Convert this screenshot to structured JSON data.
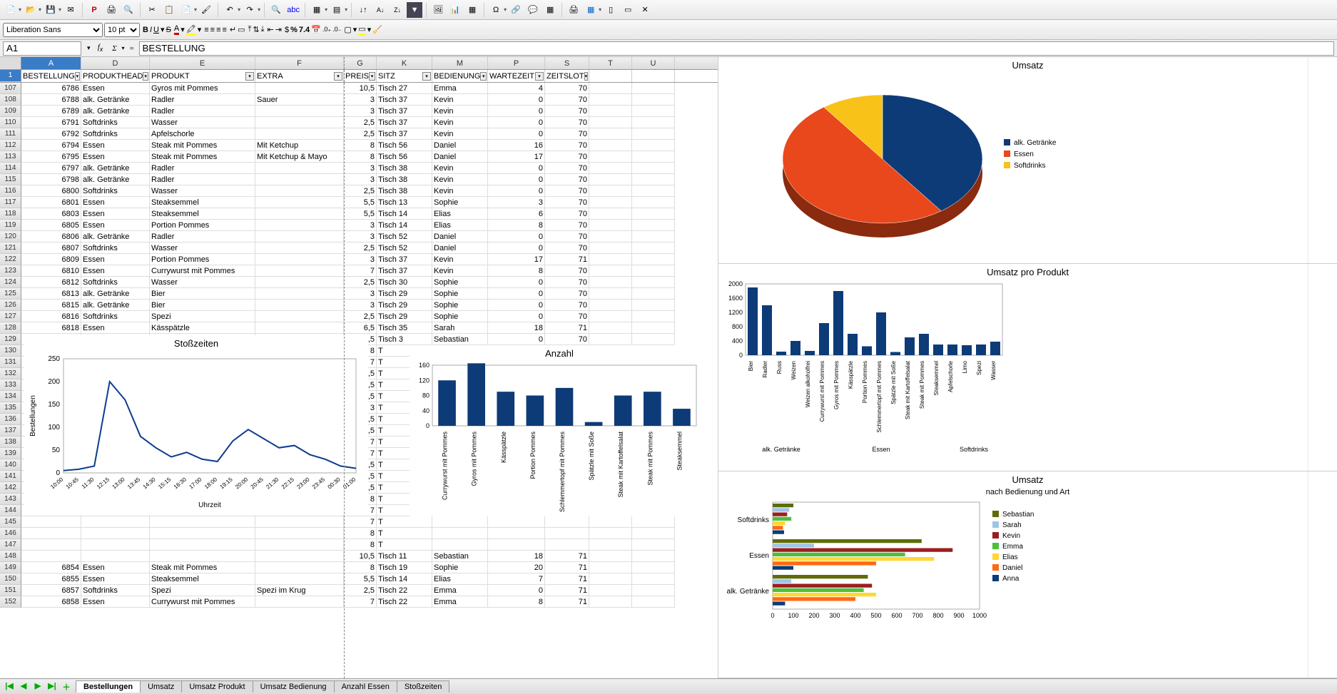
{
  "app": {
    "font_name": "Liberation Sans",
    "font_size": "10 pt"
  },
  "cell_reference": "A1",
  "formula_value": "BESTELLUNG",
  "columns": [
    {
      "id": "A",
      "label": "A",
      "w": "col-A"
    },
    {
      "id": "D",
      "label": "D",
      "w": "col-D"
    },
    {
      "id": "E",
      "label": "E",
      "w": "col-El"
    },
    {
      "id": "F",
      "label": "F",
      "w": "col-F"
    },
    {
      "id": "G",
      "label": "G",
      "w": "col-G"
    },
    {
      "id": "K",
      "label": "K",
      "w": "col-K"
    },
    {
      "id": "M",
      "label": "M",
      "w": "col-M"
    },
    {
      "id": "P",
      "label": "P",
      "w": "col-P"
    },
    {
      "id": "S",
      "label": "S",
      "w": "col-S"
    },
    {
      "id": "T",
      "label": "T",
      "w": "col-T"
    },
    {
      "id": "U",
      "label": "U",
      "w": "col-U"
    }
  ],
  "filters": [
    "BESTELLUNG",
    "PRODUKTHEAD",
    "PRODUKT",
    "EXTRA",
    "PREIS",
    "SITZ",
    "BEDIENUNG",
    "WARTEZEIT",
    "ZEITSLOT",
    "",
    ""
  ],
  "rows": [
    {
      "n": 107,
      "a": "6786",
      "d": "Essen",
      "e": "Gyros mit Pommes",
      "f": "",
      "g": "10,5",
      "k": "Tisch 27",
      "m": "Emma",
      "p": "4",
      "s": "70"
    },
    {
      "n": 108,
      "a": "6788",
      "d": "alk. Getränke",
      "e": "Radler",
      "f": "Sauer",
      "g": "3",
      "k": "Tisch 37",
      "m": "Kevin",
      "p": "0",
      "s": "70"
    },
    {
      "n": 109,
      "a": "6789",
      "d": "alk. Getränke",
      "e": "Radler",
      "f": "",
      "g": "3",
      "k": "Tisch 37",
      "m": "Kevin",
      "p": "0",
      "s": "70"
    },
    {
      "n": 110,
      "a": "6791",
      "d": "Softdrinks",
      "e": "Wasser",
      "f": "",
      "g": "2,5",
      "k": "Tisch 37",
      "m": "Kevin",
      "p": "0",
      "s": "70"
    },
    {
      "n": 111,
      "a": "6792",
      "d": "Softdrinks",
      "e": "Apfelschorle",
      "f": "",
      "g": "2,5",
      "k": "Tisch 37",
      "m": "Kevin",
      "p": "0",
      "s": "70"
    },
    {
      "n": 112,
      "a": "6794",
      "d": "Essen",
      "e": "Steak mit Pommes",
      "f": "Mit Ketchup",
      "g": "8",
      "k": "Tisch 56",
      "m": "Daniel",
      "p": "16",
      "s": "70"
    },
    {
      "n": 113,
      "a": "6795",
      "d": "Essen",
      "e": "Steak mit Pommes",
      "f": "Mit Ketchup & Mayo",
      "g": "8",
      "k": "Tisch 56",
      "m": "Daniel",
      "p": "17",
      "s": "70"
    },
    {
      "n": 114,
      "a": "6797",
      "d": "alk. Getränke",
      "e": "Radler",
      "f": "",
      "g": "3",
      "k": "Tisch 38",
      "m": "Kevin",
      "p": "0",
      "s": "70"
    },
    {
      "n": 115,
      "a": "6798",
      "d": "alk. Getränke",
      "e": "Radler",
      "f": "",
      "g": "3",
      "k": "Tisch 38",
      "m": "Kevin",
      "p": "0",
      "s": "70"
    },
    {
      "n": 116,
      "a": "6800",
      "d": "Softdrinks",
      "e": "Wasser",
      "f": "",
      "g": "2,5",
      "k": "Tisch 38",
      "m": "Kevin",
      "p": "0",
      "s": "70"
    },
    {
      "n": 117,
      "a": "6801",
      "d": "Essen",
      "e": "Steaksemmel",
      "f": "",
      "g": "5,5",
      "k": "Tisch 13",
      "m": "Sophie",
      "p": "3",
      "s": "70"
    },
    {
      "n": 118,
      "a": "6803",
      "d": "Essen",
      "e": "Steaksemmel",
      "f": "",
      "g": "5,5",
      "k": "Tisch 14",
      "m": "Elias",
      "p": "6",
      "s": "70"
    },
    {
      "n": 119,
      "a": "6805",
      "d": "Essen",
      "e": "Portion Pommes",
      "f": "",
      "g": "3",
      "k": "Tisch 14",
      "m": "Elias",
      "p": "8",
      "s": "70"
    },
    {
      "n": 120,
      "a": "6806",
      "d": "alk. Getränke",
      "e": "Radler",
      "f": "",
      "g": "3",
      "k": "Tisch 52",
      "m": "Daniel",
      "p": "0",
      "s": "70"
    },
    {
      "n": 121,
      "a": "6807",
      "d": "Softdrinks",
      "e": "Wasser",
      "f": "",
      "g": "2,5",
      "k": "Tisch 52",
      "m": "Daniel",
      "p": "0",
      "s": "70"
    },
    {
      "n": 122,
      "a": "6809",
      "d": "Essen",
      "e": "Portion Pommes",
      "f": "",
      "g": "3",
      "k": "Tisch 37",
      "m": "Kevin",
      "p": "17",
      "s": "71"
    },
    {
      "n": 123,
      "a": "6810",
      "d": "Essen",
      "e": "Currywurst mit Pommes",
      "f": "",
      "g": "7",
      "k": "Tisch 37",
      "m": "Kevin",
      "p": "8",
      "s": "70"
    },
    {
      "n": 124,
      "a": "6812",
      "d": "Softdrinks",
      "e": "Wasser",
      "f": "",
      "g": "2,5",
      "k": "Tisch 30",
      "m": "Sophie",
      "p": "0",
      "s": "70"
    },
    {
      "n": 125,
      "a": "6813",
      "d": "alk. Getränke",
      "e": "Bier",
      "f": "",
      "g": "3",
      "k": "Tisch 29",
      "m": "Sophie",
      "p": "0",
      "s": "70"
    },
    {
      "n": 126,
      "a": "6815",
      "d": "alk. Getränke",
      "e": "Bier",
      "f": "",
      "g": "3",
      "k": "Tisch 29",
      "m": "Sophie",
      "p": "0",
      "s": "70"
    },
    {
      "n": 127,
      "a": "6816",
      "d": "Softdrinks",
      "e": "Spezi",
      "f": "",
      "g": "2,5",
      "k": "Tisch 29",
      "m": "Sophie",
      "p": "0",
      "s": "70"
    },
    {
      "n": 128,
      "a": "6818",
      "d": "Essen",
      "e": "Kässpätzle",
      "f": "",
      "g": "6,5",
      "k": "Tisch 35",
      "m": "Sarah",
      "p": "18",
      "s": "71"
    },
    {
      "n": 129,
      "a": "",
      "d": "",
      "e": "",
      "f": "",
      "g": "2,5",
      "k": "Tisch 3",
      "m": "Sebastian",
      "p": "0",
      "s": "70"
    },
    {
      "n": 130,
      "a": "",
      "d": "",
      "e": "",
      "f": "",
      "g": "8",
      "k": "T",
      "m": "",
      "p": "",
      "s": ""
    },
    {
      "n": 131,
      "a": "",
      "d": "",
      "e": "",
      "f": "",
      "g": "7",
      "k": "T",
      "m": "",
      "p": "",
      "s": ""
    },
    {
      "n": 132,
      "a": "",
      "d": "",
      "e": "",
      "f": "",
      "g": "5,5",
      "k": "T",
      "m": "",
      "p": "",
      "s": ""
    },
    {
      "n": 133,
      "a": "",
      "d": "",
      "e": "",
      "f": "",
      "g": "2,5",
      "k": "T",
      "m": "",
      "p": "",
      "s": ""
    },
    {
      "n": 134,
      "a": "",
      "d": "",
      "e": "",
      "f": "",
      "g": "2,5",
      "k": "T",
      "m": "",
      "p": "",
      "s": ""
    },
    {
      "n": 135,
      "a": "",
      "d": "",
      "e": "",
      "f": "",
      "g": "3",
      "k": "T",
      "m": "",
      "p": "",
      "s": ""
    },
    {
      "n": 136,
      "a": "",
      "d": "",
      "e": "",
      "f": "",
      "g": "2,5",
      "k": "T",
      "m": "",
      "p": "",
      "s": ""
    },
    {
      "n": 137,
      "a": "",
      "d": "",
      "e": "",
      "f": "",
      "g": "3,5",
      "k": "T",
      "m": "",
      "p": "",
      "s": ""
    },
    {
      "n": 138,
      "a": "",
      "d": "",
      "e": "",
      "f": "",
      "g": "7",
      "k": "T",
      "m": "",
      "p": "",
      "s": ""
    },
    {
      "n": 139,
      "a": "",
      "d": "",
      "e": "",
      "f": "",
      "g": "7",
      "k": "T",
      "m": "",
      "p": "",
      "s": ""
    },
    {
      "n": 140,
      "a": "",
      "d": "",
      "e": "",
      "f": "",
      "g": "3,5",
      "k": "T",
      "m": "",
      "p": "",
      "s": ""
    },
    {
      "n": 141,
      "a": "",
      "d": "",
      "e": "",
      "f": "",
      "g": "2,5",
      "k": "T",
      "m": "",
      "p": "",
      "s": ""
    },
    {
      "n": 142,
      "a": "",
      "d": "",
      "e": "",
      "f": "",
      "g": "2,5",
      "k": "T",
      "m": "",
      "p": "",
      "s": ""
    },
    {
      "n": 143,
      "a": "",
      "d": "",
      "e": "",
      "f": "",
      "g": "8",
      "k": "T",
      "m": "",
      "p": "",
      "s": ""
    },
    {
      "n": 144,
      "a": "",
      "d": "",
      "e": "",
      "f": "",
      "g": "7",
      "k": "T",
      "m": "",
      "p": "",
      "s": ""
    },
    {
      "n": 145,
      "a": "",
      "d": "",
      "e": "",
      "f": "",
      "g": "7",
      "k": "T",
      "m": "",
      "p": "",
      "s": ""
    },
    {
      "n": 146,
      "a": "",
      "d": "",
      "e": "",
      "f": "",
      "g": "8",
      "k": "T",
      "m": "",
      "p": "",
      "s": ""
    },
    {
      "n": 147,
      "a": "",
      "d": "",
      "e": "",
      "f": "",
      "g": "8",
      "k": "T",
      "m": "",
      "p": "",
      "s": ""
    },
    {
      "n": 148,
      "a": "",
      "d": "",
      "e": "",
      "f": "",
      "g": "10,5",
      "k": "Tisch 11",
      "m": "Sebastian",
      "p": "18",
      "s": "71"
    },
    {
      "n": 149,
      "a": "6854",
      "d": "Essen",
      "e": "Steak mit Pommes",
      "f": "",
      "g": "8",
      "k": "Tisch 19",
      "m": "Sophie",
      "p": "20",
      "s": "71"
    },
    {
      "n": 150,
      "a": "6855",
      "d": "Essen",
      "e": "Steaksemmel",
      "f": "",
      "g": "5,5",
      "k": "Tisch 14",
      "m": "Elias",
      "p": "7",
      "s": "71"
    },
    {
      "n": 151,
      "a": "6857",
      "d": "Softdrinks",
      "e": "Spezi",
      "f": "Spezi im Krug",
      "g": "2,5",
      "k": "Tisch 22",
      "m": "Emma",
      "p": "0",
      "s": "71"
    },
    {
      "n": 152,
      "a": "6858",
      "d": "Essen",
      "e": "Currywurst mit Pommes",
      "f": "",
      "g": "7",
      "k": "Tisch 22",
      "m": "Emma",
      "p": "8",
      "s": "71"
    }
  ],
  "sheet_tabs": [
    "Bestellungen",
    "Umsatz",
    "Umsatz Produkt",
    "Umsatz Bedienung",
    "Anzahl Essen",
    "Stoßzeiten"
  ],
  "active_tab": 0,
  "chart_data": [
    {
      "type": "line",
      "title": "Stoßzeiten",
      "xlabel": "Uhrzeit",
      "ylabel": "Bestellungen",
      "ylim": [
        0,
        250
      ],
      "x": [
        "10:00",
        "10:45",
        "11:30",
        "12:15",
        "13:00",
        "13:45",
        "14:30",
        "15:15",
        "16:30",
        "17:00",
        "18:00",
        "19:15",
        "20:00",
        "20:45",
        "21:30",
        "22:15",
        "23:00",
        "23:45",
        "00:30",
        "01:00"
      ],
      "values": [
        5,
        8,
        15,
        200,
        160,
        80,
        55,
        35,
        45,
        30,
        25,
        70,
        95,
        75,
        55,
        60,
        40,
        30,
        15,
        10
      ]
    },
    {
      "type": "bar",
      "title": "Anzahl",
      "ylim": [
        0,
        160
      ],
      "yticks": [
        0,
        40,
        80,
        120,
        160
      ],
      "categories": [
        "Currywurst mit Pommes",
        "Gyros mit Pommes",
        "Kässpätzle",
        "Portion Pommes",
        "Schlemmertopf mit Pommes",
        "Spätzle mit Soße",
        "Steak mit Kartoffelsalat",
        "Steak mit Pommes",
        "Steaksemmel"
      ],
      "values": [
        120,
        165,
        90,
        80,
        100,
        10,
        80,
        90,
        45
      ]
    },
    {
      "type": "pie",
      "title": "Umsatz",
      "slices": [
        {
          "label": "alk. Getränke",
          "value": 40,
          "color": "#0d3b77"
        },
        {
          "label": "Essen",
          "value": 50,
          "color": "#e8481b"
        },
        {
          "label": "Softdrinks",
          "value": 10,
          "color": "#f8c218"
        }
      ]
    },
    {
      "type": "bar",
      "title": "Umsatz pro Produkt",
      "ylim": [
        0,
        2000
      ],
      "yticks": [
        0,
        400,
        800,
        1200,
        1600,
        2000
      ],
      "group_labels": [
        "alk. Getränke",
        "Essen",
        "Softdrinks"
      ],
      "categories": [
        "Bier",
        "Radler",
        "Russ",
        "Weizen",
        "Weizen alkoholfrei",
        "Currywurst mit Pommes",
        "Gyros mit Pommes",
        "Kässpätzle",
        "Portion Pommes",
        "Schlemmertopf mit Pommes",
        "Spätzle mit Soße",
        "Steak mit Kartoffelsalat",
        "Steak mit Pommes",
        "Steaksemmel",
        "Apfelschorle",
        "Limo",
        "Spezi",
        "Wasser"
      ],
      "values": [
        1900,
        1400,
        100,
        400,
        120,
        900,
        1800,
        600,
        250,
        1200,
        90,
        500,
        600,
        300,
        300,
        280,
        300,
        380
      ]
    },
    {
      "type": "bar_horizontal_grouped",
      "title": "Umsatz",
      "subtitle": "nach Bedienung und Art",
      "xlim": [
        0,
        1000
      ],
      "xticks": [
        0,
        100,
        200,
        300,
        400,
        500,
        600,
        700,
        800,
        900,
        1000
      ],
      "ycats": [
        "Softdrinks",
        "Essen",
        "alk. Getränke"
      ],
      "series": [
        {
          "name": "Sebastian",
          "color": "#5f6b0a",
          "values": [
            100,
            720,
            460
          ]
        },
        {
          "name": "Sarah",
          "color": "#9fc4e7",
          "values": [
            80,
            200,
            90
          ]
        },
        {
          "name": "Kevin",
          "color": "#9a1e1e",
          "values": [
            70,
            870,
            480
          ]
        },
        {
          "name": "Emma",
          "color": "#4fbf3a",
          "values": [
            90,
            640,
            440
          ]
        },
        {
          "name": "Elias",
          "color": "#ffd732",
          "values": [
            60,
            780,
            500
          ]
        },
        {
          "name": "Daniel",
          "color": "#ff6a13",
          "values": [
            50,
            500,
            400
          ]
        },
        {
          "name": "Anna",
          "color": "#0d3b77",
          "values": [
            55,
            100,
            60
          ]
        }
      ]
    }
  ]
}
